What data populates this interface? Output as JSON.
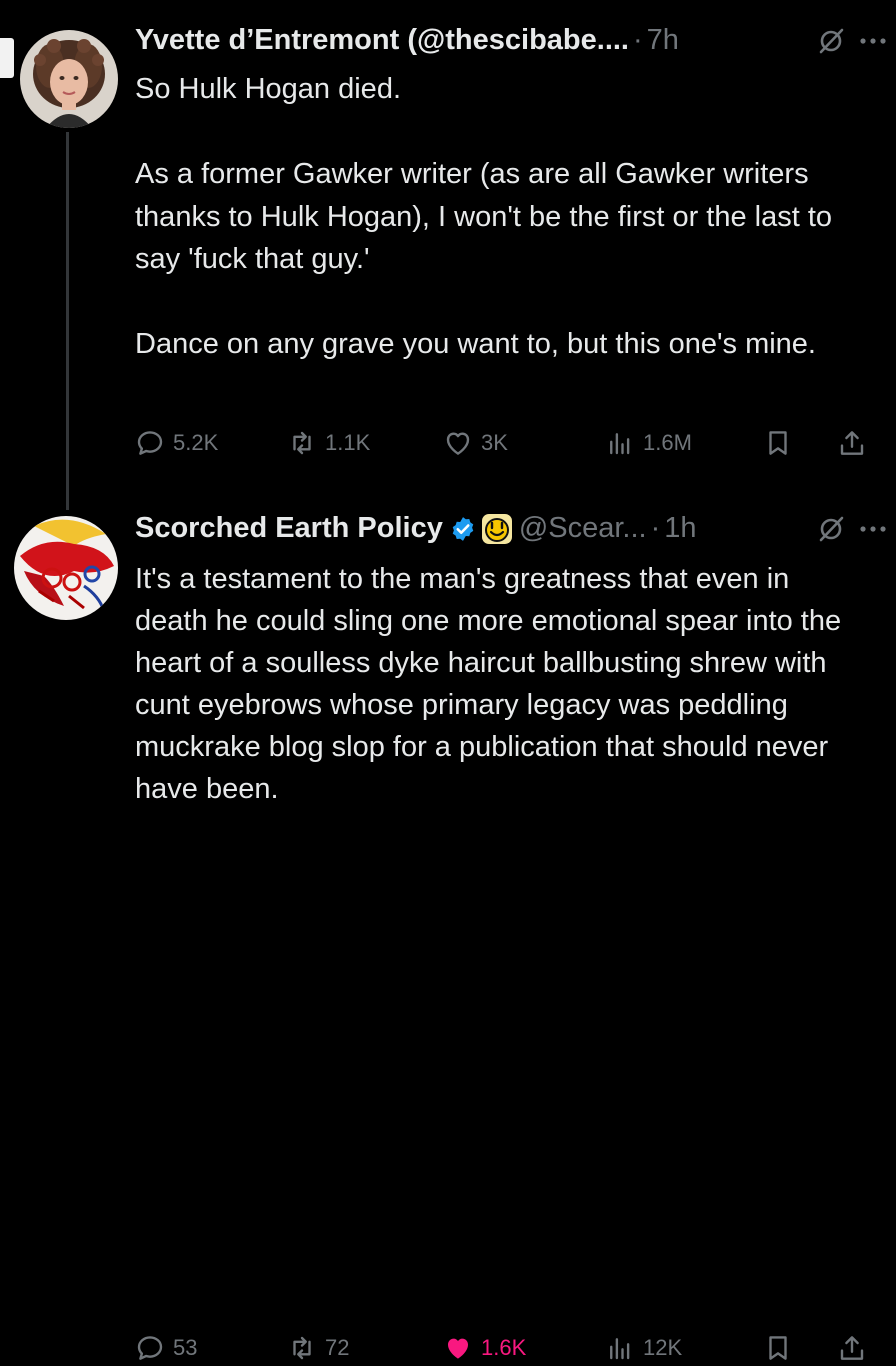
{
  "tweets": [
    {
      "author_name": "Yvette d’Entremont (@thescibabe....",
      "separator": "·",
      "time": "7h",
      "text": "So Hulk Hogan died.\n\nAs a former Gawker writer (as are all Gawker writers thanks to Hulk Hogan), I won't be the first or the last to say 'fuck that guy.'\n\nDance on any grave you want to, but this one's mine.",
      "replies": "5.2K",
      "reposts": "1.1K",
      "likes": "3K",
      "views": "1.6M",
      "liked": false,
      "avatar_icon": "profile-photo-woman"
    },
    {
      "author_name": "Scorched Earth Policy",
      "handle": "@Scear...",
      "separator": "·",
      "time": "1h",
      "verified": true,
      "badge_icon": "yellow-emoji-badge",
      "text": "It's a testament to the man's greatness that even in death he could sling one more emotional spear into the heart of a soulless dyke haircut ballbusting shrew with cunt eyebrows whose primary legacy was peddling muckrake blog slop for a publication that should never have been.",
      "replies": "53",
      "reposts": "72",
      "likes": "1.6K",
      "views": "12K",
      "liked": true,
      "avatar_icon": "red-splatter-artwork-avatar"
    }
  ],
  "colors": {
    "background": "#000000",
    "text": "#e7e9ea",
    "muted": "#71767b",
    "like_active": "#f91880",
    "verified": "#1d9bf0",
    "thread_line": "#333639"
  }
}
